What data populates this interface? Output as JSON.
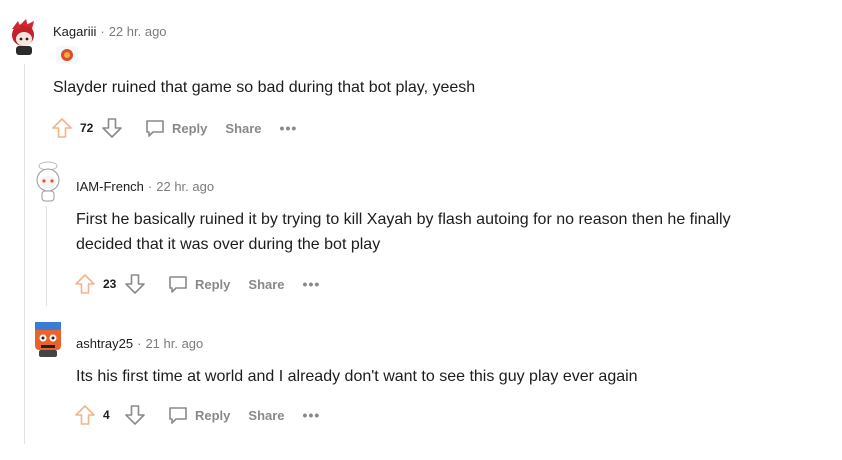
{
  "comments": [
    {
      "author": "Kagariii",
      "time": "22 hr. ago",
      "text": "Slayder ruined that game so bad during that bot play, yeesh",
      "score": "72",
      "reply_label": "Reply",
      "share_label": "Share",
      "more_label": "•••"
    },
    {
      "author": "IAM-French",
      "time": "22 hr. ago",
      "text": "First he basically ruined it by trying to kill Xayah by flash autoing for no reason then he finally decided that it was over during the bot play",
      "score": "23",
      "reply_label": "Reply",
      "share_label": "Share",
      "more_label": "•••"
    },
    {
      "author": "ashtray25",
      "time": "21 hr. ago",
      "text": "Its his first time at world and I already don't want to see this guy play ever again",
      "score": "4",
      "reply_label": "Reply",
      "share_label": "Share",
      "more_label": "•••"
    }
  ],
  "separator": "·",
  "colors": {
    "upvote": "#f2b38a",
    "icon_gray": "#878a8c",
    "thread_line": "#e1e3e5"
  },
  "icons": [
    "upvote-icon",
    "downvote-icon",
    "reply-bubble-icon",
    "more-dots-icon"
  ]
}
